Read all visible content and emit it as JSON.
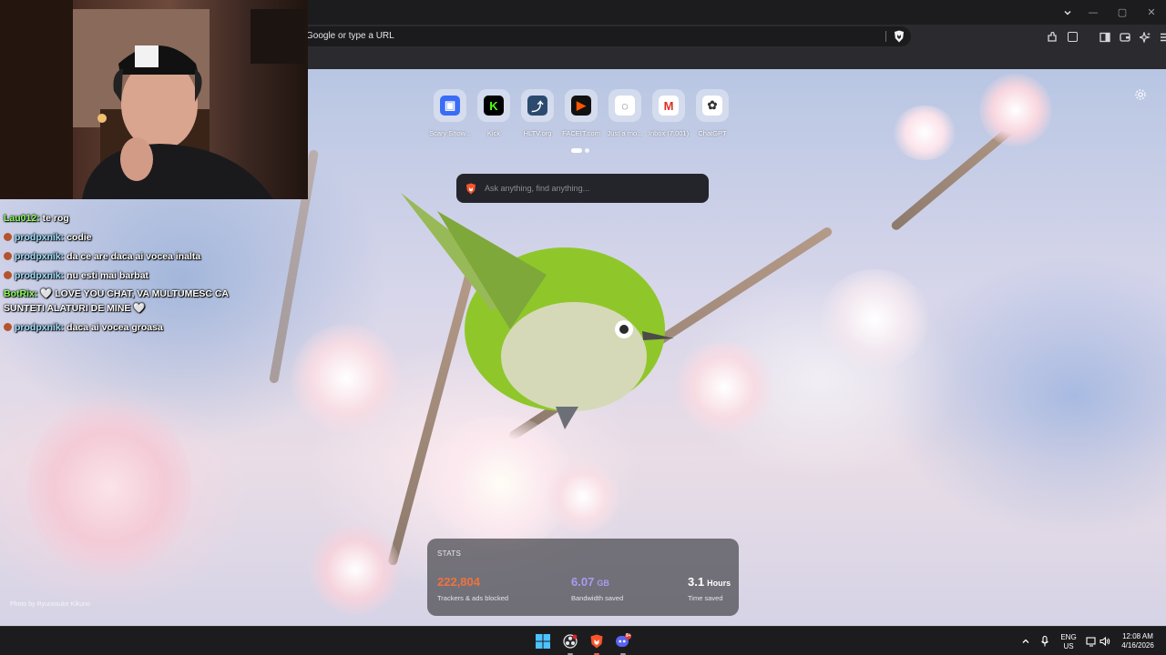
{
  "browser": {
    "address_placeholder": "Google or type a URL",
    "window_controls": [
      "—",
      "▢",
      "✕"
    ]
  },
  "new_tab": {
    "top_sites": [
      {
        "label": "Scary Show...",
        "icon": "roblox-icon",
        "color": "#3b6cf6",
        "glyph": "▣"
      },
      {
        "label": "Kick",
        "icon": "kick-icon",
        "color": "#000000",
        "glyph": "K"
      },
      {
        "label": "HLTV.org",
        "icon": "hltv-icon",
        "color": "#2c4a6e",
        "glyph": "⤴"
      },
      {
        "label": "FACEIT.com",
        "icon": "faceit-icon",
        "color": "#111111",
        "glyph": "▶"
      },
      {
        "label": "Just a mo...",
        "icon": "loading-icon",
        "color": "#ffffff",
        "glyph": "◌"
      },
      {
        "label": "Inbox (7,001)",
        "icon": "gmail-icon",
        "color": "#ffffff",
        "glyph": "M"
      },
      {
        "label": "ChatGPT",
        "icon": "chatgpt-icon",
        "color": "#ffffff",
        "glyph": "✿"
      }
    ],
    "search_placeholder": "Ask anything, find anything...",
    "stats": {
      "title": "STATS",
      "items": [
        {
          "value": "222,804",
          "unit": "",
          "label": "Trackers & ads blocked",
          "color": "#f0733e"
        },
        {
          "value": "6.07",
          "unit": "GB",
          "label": "Bandwidth saved",
          "color": "#a99bf0"
        },
        {
          "value": "3.1",
          "unit": "Hours",
          "label": "Time saved",
          "color": "#ffffff"
        }
      ]
    },
    "photo_credit": "Photo by Ryunosuke Kikuno"
  },
  "chat": [
    {
      "user": "Lau012",
      "sep": ":",
      "text": " te rog",
      "badge": false,
      "user_color": "green"
    },
    {
      "user": "prodpxnik",
      "sep": ":",
      "text": " codie",
      "badge": true,
      "user_color": "blue"
    },
    {
      "user": "prodpxnik",
      "sep": ":",
      "text": " da ce are daca ai vocea inalta",
      "badge": true,
      "user_color": "blue"
    },
    {
      "user": "prodpxnik",
      "sep": ":",
      "text": " nu esti mai barbat",
      "badge": true,
      "user_color": "blue"
    },
    {
      "user": "BotRix",
      "sep": ":",
      "text": " 🤍 LOVE YOU CHAT, VA MULTUMESC CA",
      "badge": false,
      "user_color": "green"
    },
    {
      "user": "",
      "sep": "",
      "text": "SUNTETI ALATURI DE MINE 🤍",
      "badge": false,
      "user_color": "green"
    },
    {
      "user": "prodpxnik",
      "sep": ":",
      "text": " daca ai vocea groasa",
      "badge": true,
      "user_color": "blue"
    }
  ],
  "taskbar": {
    "apps": [
      {
        "name": "windows-start-icon"
      },
      {
        "name": "obs-icon"
      },
      {
        "name": "brave-icon"
      },
      {
        "name": "discord-icon",
        "badge": "9+"
      }
    ],
    "tray": {
      "language": "ENG",
      "region": "US",
      "time": "12:08 AM",
      "date": "4/16/2026"
    }
  }
}
